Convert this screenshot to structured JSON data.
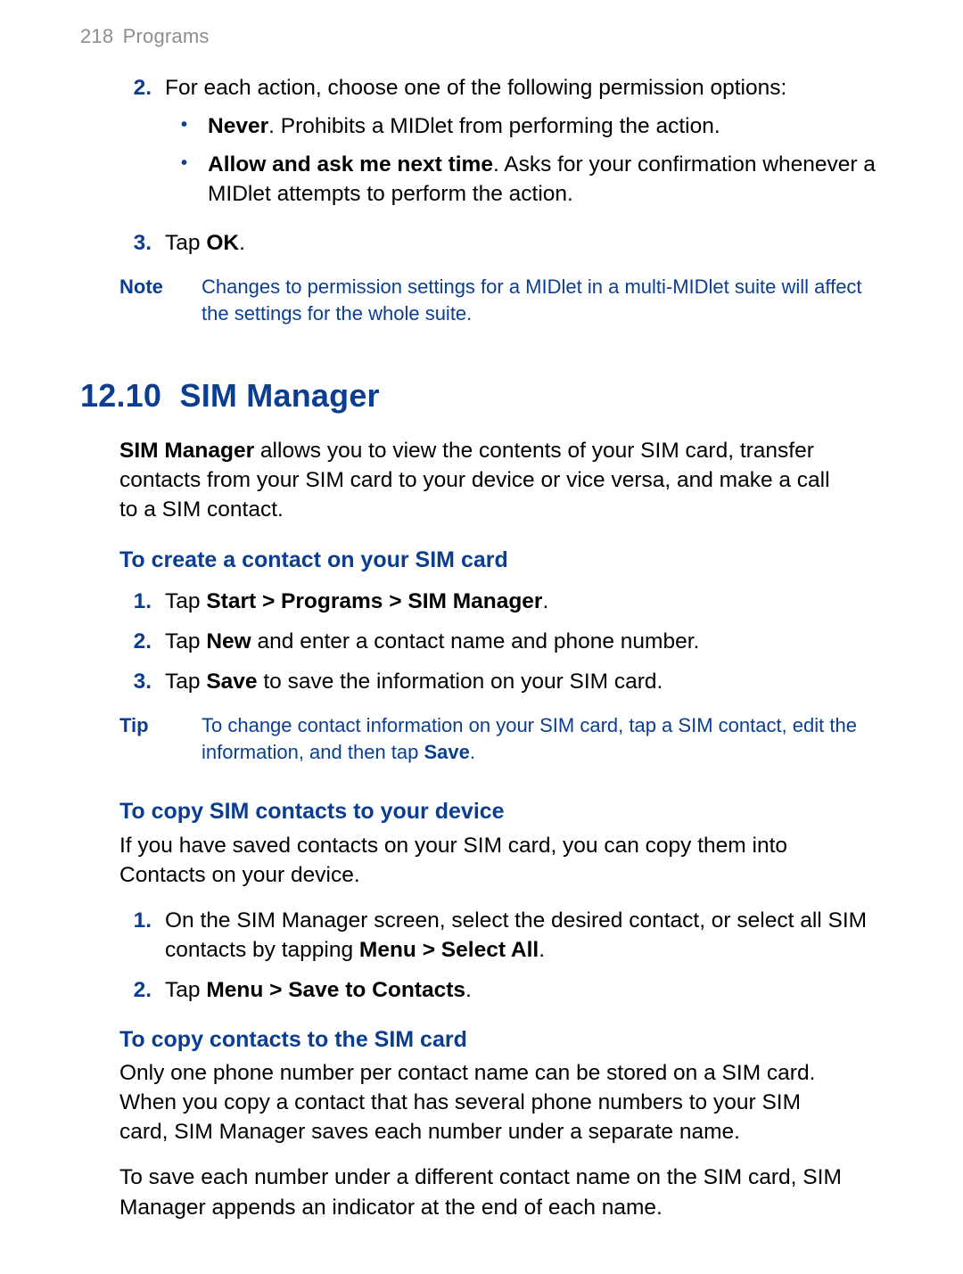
{
  "header": {
    "page_number": "218",
    "chapter": "Programs"
  },
  "top_list": {
    "item2": {
      "num": "2.",
      "text": "For each action, choose one of the following permission options:",
      "bullets": [
        {
          "bold": "Never",
          "rest": ". Prohibits a MIDlet from performing the action."
        },
        {
          "bold": "Allow and ask me next time",
          "rest": ". Asks for your confirmation whenever a MIDlet attempts to perform the action."
        }
      ]
    },
    "item3": {
      "num": "3.",
      "pre": "Tap ",
      "bold": "OK",
      "post": "."
    }
  },
  "note": {
    "label": "Note",
    "text": "Changes to permission settings for a MIDlet in a multi-MIDlet suite will affect the settings for the whole suite."
  },
  "section": {
    "number": "12.10",
    "title": "SIM Manager",
    "intro_bold": "SIM Manager",
    "intro_rest": " allows you to view the contents of your SIM card, transfer contacts from your SIM card to your device or vice versa, and make a call to a SIM contact."
  },
  "create": {
    "heading": "To create a contact on your SIM card",
    "steps": [
      {
        "num": "1.",
        "pre": "Tap ",
        "bold": "Start > Programs > SIM Manager",
        "post": "."
      },
      {
        "num": "2.",
        "pre": "Tap ",
        "bold": "New",
        "post": " and enter a contact name and phone number."
      },
      {
        "num": "3.",
        "pre": "Tap ",
        "bold": "Save",
        "post": " to save the information on your SIM card."
      }
    ]
  },
  "tip": {
    "label": "Tip",
    "text_pre": "To change contact information on your SIM card, tap a SIM contact, edit the information, and then tap ",
    "text_bold": "Save",
    "text_post": "."
  },
  "copy_to_device": {
    "heading": "To copy SIM contacts to your device",
    "intro": "If you have saved contacts on your SIM card, you can copy them into Contacts on your device.",
    "steps": [
      {
        "num": "1.",
        "pre": "On the SIM Manager screen, select the desired contact, or select all SIM contacts by tapping ",
        "bold": "Menu > Select All",
        "post": "."
      },
      {
        "num": "2.",
        "pre": "Tap ",
        "bold": "Menu > Save to Contacts",
        "post": "."
      }
    ]
  },
  "copy_to_sim": {
    "heading": "To copy contacts to the SIM card",
    "para1": "Only one phone number per contact name can be stored on a SIM card. When you copy a contact that has several phone numbers to your SIM card, SIM Manager saves each number under a separate name.",
    "para2": "To save each number under a different contact name on the SIM card, SIM Manager appends an indicator at the end of each name."
  }
}
